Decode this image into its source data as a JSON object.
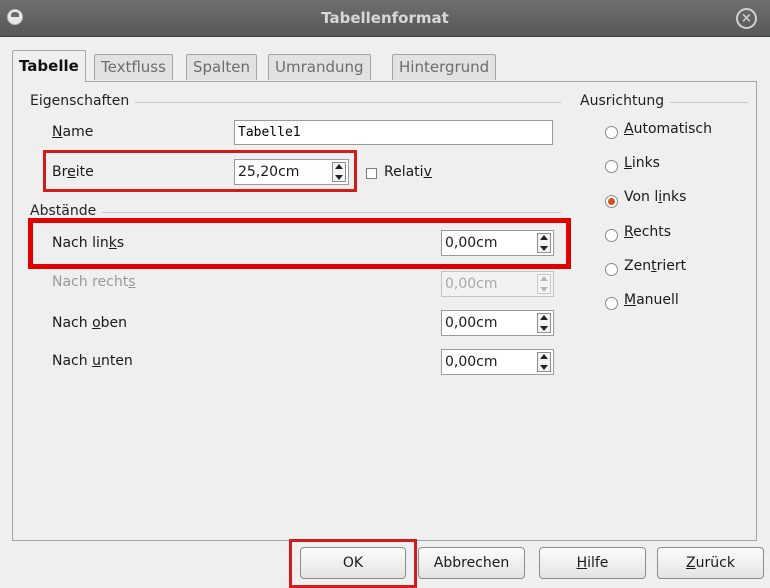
{
  "window": {
    "title": "Tabellenformat"
  },
  "tabs": [
    "Tabelle",
    "Textfluss",
    "Spalten",
    "Umrandung",
    "Hintergrund"
  ],
  "properties": {
    "section": "Eigenschaften",
    "name_label": "Name",
    "name_value": "Tabelle1",
    "width_label": "Breite",
    "width_value": "25,20cm",
    "relative_label": "Relativ"
  },
  "spacing": {
    "section": "Abstände",
    "left_label": "Nach links",
    "left_value": "0,00cm",
    "right_label": "Nach rechts",
    "right_value": "0,00cm",
    "top_label": "Nach oben",
    "top_value": "0,00cm",
    "bottom_label": "Nach unten",
    "bottom_value": "0,00cm"
  },
  "alignment": {
    "section": "Ausrichtung",
    "options": [
      "Automatisch",
      "Links",
      "Von links",
      "Rechts",
      "Zentriert",
      "Manuell"
    ],
    "selected": "Von links"
  },
  "buttons": {
    "ok": "OK",
    "cancel": "Abbrechen",
    "help": "Hilfe",
    "back": "Zurück"
  },
  "colors": {
    "highlight": "#e00000",
    "radio_selected": "#d4511a",
    "titlebar": "#616363"
  }
}
